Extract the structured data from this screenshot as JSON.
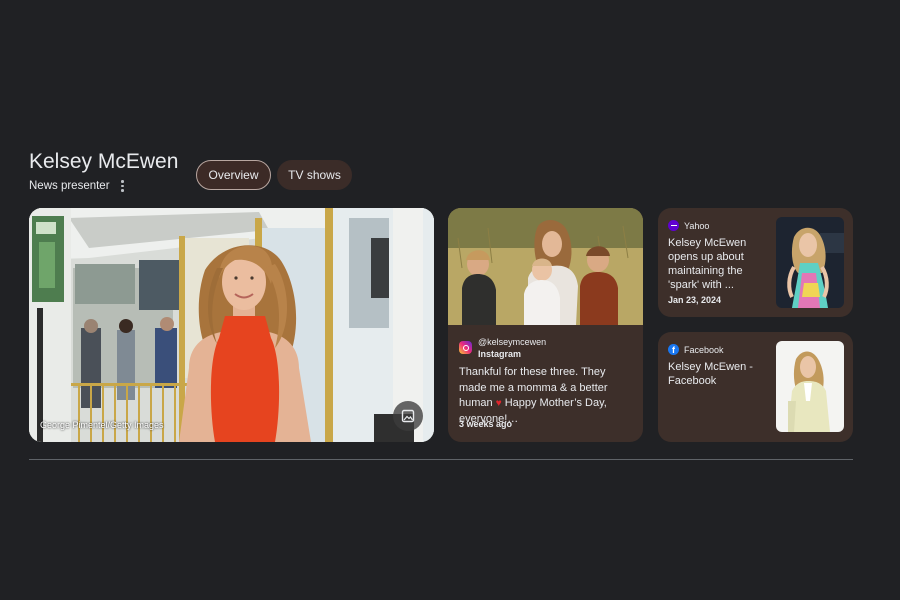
{
  "header": {
    "title": "Kelsey McEwen",
    "subtitle": "News presenter"
  },
  "chips": [
    {
      "label": "Overview",
      "selected": true
    },
    {
      "label": "TV shows",
      "selected": false
    }
  ],
  "hero": {
    "credit": "George Pimentel/Getty Images",
    "image_button_icon": "image-icon"
  },
  "instagram_post": {
    "handle": "@kelseymcewen",
    "source": "Instagram",
    "text": "Thankful for these three. They made me a momma & a better human",
    "emoji": "♥",
    "text2": "Happy Mother’s Day, everyone!…",
    "time": "3 weeks ago"
  },
  "yahoo_card": {
    "source": "Yahoo",
    "title": "Kelsey McEwen opens up about maintaining the 'spark' with ...",
    "date": "Jan 23, 2024"
  },
  "facebook_card": {
    "source": "Facebook",
    "title": "Kelsey McEwen - Facebook"
  },
  "colors": {
    "background": "#202124",
    "card": "#3d2f2a",
    "chip_selected": "#3c2a26",
    "dress": "#e6441f"
  }
}
